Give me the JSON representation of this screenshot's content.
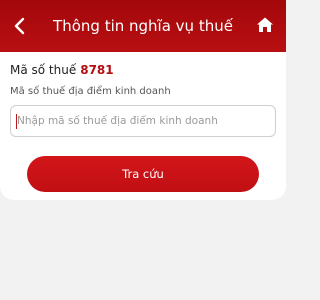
{
  "header": {
    "title": "Thông tin nghĩa vụ thuế",
    "back_icon": "chevron-left-icon",
    "home_icon": "home-icon"
  },
  "form": {
    "tax_code_label": "Mã số thuế",
    "tax_code_value": "8781",
    "location_label": "Mã số thuế địa điểm kinh doanh",
    "location_placeholder": "Nhập mã số thuế địa điểm kinh doanh",
    "location_value": "",
    "submit_label": "Tra cứu"
  },
  "colors": {
    "brand": "#b80f12",
    "page_background": "#f2f2f2"
  }
}
